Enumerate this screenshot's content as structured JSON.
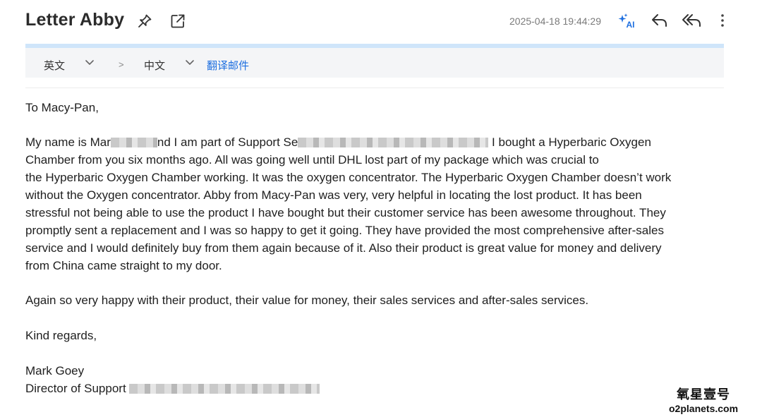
{
  "header": {
    "subject": "Letter Abby",
    "timestamp": "2025-04-18 19:44:29",
    "icons": [
      "pin-icon",
      "popout-icon",
      "ai-sparkle-icon",
      "reply-icon",
      "reply-all-icon",
      "more-vertical-icon"
    ],
    "ai_label": "AI"
  },
  "translation": {
    "source_lang": "英文",
    "arrow": ">",
    "target_lang": "中文",
    "translate_link": "翻译邮件"
  },
  "email": {
    "greeting": "To Macy-Pan,",
    "p1_part1": "My name is Mar",
    "p1_part2": "nd I am part of Support Se",
    "p1_part3": " I bought a Hyperbaric Oxygen",
    "p1_line2": "Chamber from you six months ago. All was going well until DHL lost part of my package which was crucial to",
    "p1_line3": "the Hyperbaric Oxygen Chamber working. It was the oxygen concentrator. The Hyperbaric Oxygen Chamber doesn’t work",
    "p1_line4": "without the Oxygen concentrator. Abby from Macy-Pan was very, very helpful in locating the lost product. It has been",
    "p1_line5": "stressful not being able to use the product I have bought but their customer service has been awesome throughout. They",
    "p1_line6": "promptly sent a replacement and I was so happy to get it going. They have provided the most comprehensive after-sales",
    "p1_line7": "service and I would definitely buy from them again because of it. Also their product is great value for money and delivery",
    "p1_line8": "from China came straight to my door.",
    "p2": "Again so very happy with their product, their value for money, their sales services and after-sales services.",
    "closing": "Kind regards,",
    "sig_name": "Mark Goey",
    "sig_title": "Director of Support"
  },
  "watermark": {
    "cn": "氧星壹号",
    "en": "o2planets.com"
  },
  "colors": {
    "accent": "#1e6fe0",
    "accent_line": "#cfe5fa",
    "trans_bg": "#f4f5f7"
  }
}
